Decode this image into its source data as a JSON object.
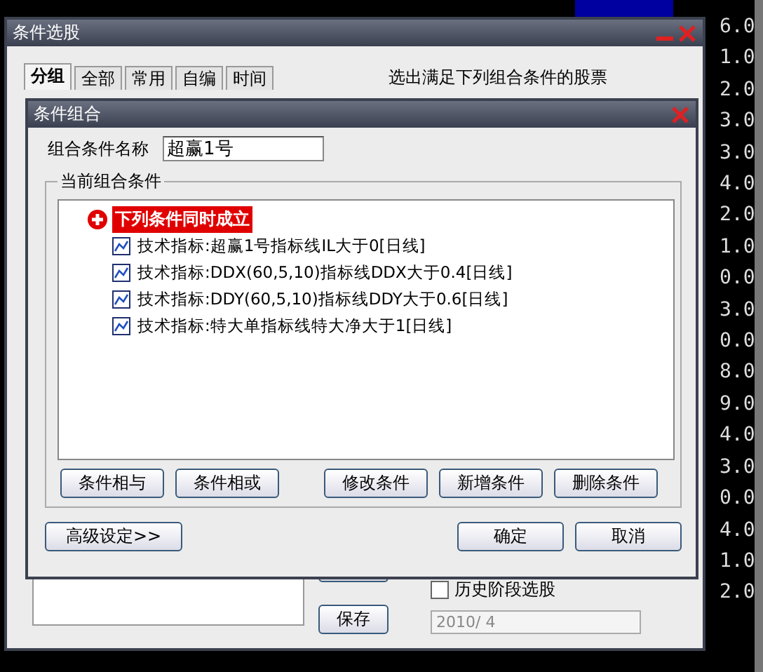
{
  "outer_window": {
    "title": "条件选股",
    "tabs": [
      {
        "label": "分组",
        "selected": true
      },
      {
        "label": "全部",
        "selected": false
      },
      {
        "label": "常用",
        "selected": false
      },
      {
        "label": "自编",
        "selected": false
      },
      {
        "label": "时间",
        "selected": false
      }
    ],
    "hint": "选出满足下列组合条件的股票",
    "save_button": "保存",
    "history_checkbox": {
      "label": "历史阶段选股",
      "checked": false
    },
    "date_field": {
      "value": "2010/ 4"
    }
  },
  "dialog": {
    "title": "条件组合",
    "name_label": "组合条件名称",
    "name_value": "超赢1号",
    "group_title": "当前组合条件",
    "tree": {
      "label": "下列条件同时成立",
      "selected": true,
      "children": [
        {
          "label": "技术指标:超赢1号指标线IL大于0[日线]",
          "selected": false
        },
        {
          "label": "技术指标:DDX(60,5,10)指标线DDX大于0.4[日线]",
          "selected": false
        },
        {
          "label": "技术指标:DDY(60,5,10)指标线DDY大于0.6[日线]",
          "selected": false
        },
        {
          "label": "技术指标:特大单指标线特大净大于1[日线]",
          "selected": false
        }
      ]
    },
    "condition_buttons": [
      "条件相与",
      "条件相或",
      "修改条件",
      "新增条件",
      "删除条件"
    ],
    "advanced_button": "高级设定>>",
    "buttons": [
      "确定",
      "取消"
    ]
  },
  "price_scale": [
    "6.0",
    "1.0",
    "2.0",
    "3.0",
    "3.0",
    "4.0",
    "2.0",
    "1.0",
    "0.0",
    "3.0",
    "0.0",
    "8.0",
    "9.0",
    "4.0",
    "3.0",
    "0.0",
    "4.0",
    "1.0",
    "2.0"
  ]
}
